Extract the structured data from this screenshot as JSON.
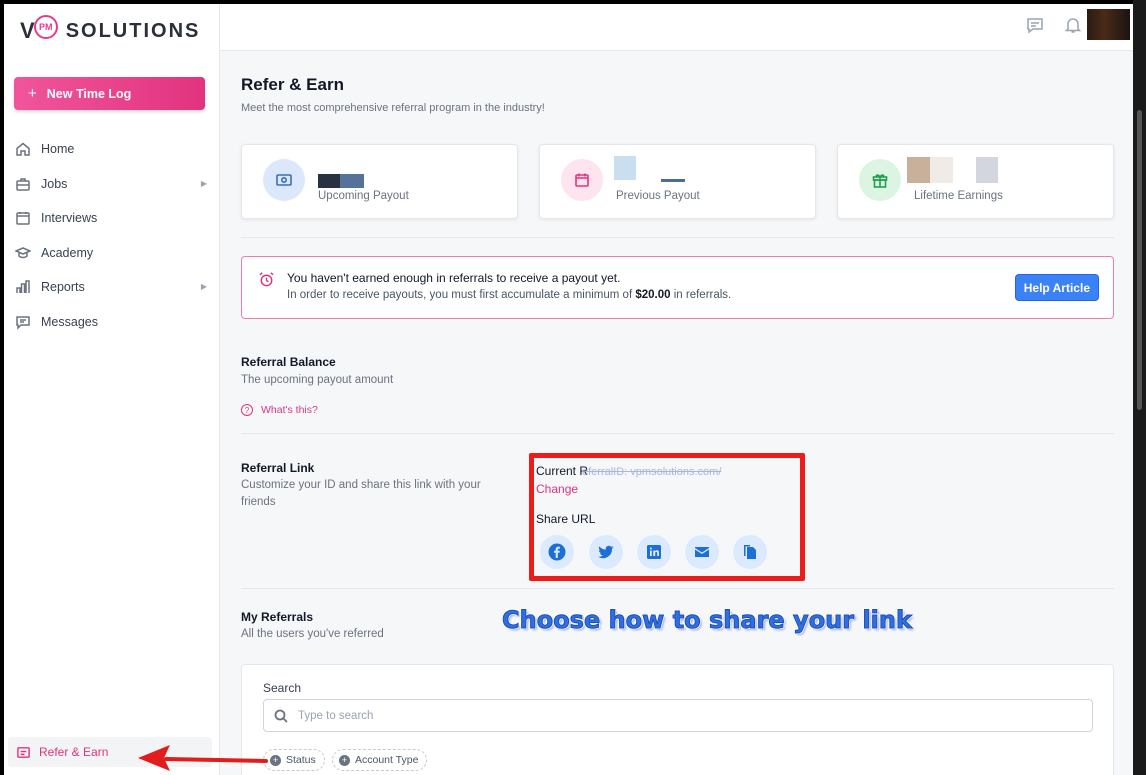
{
  "brand": {
    "v": "V",
    "pm": "PM",
    "name": "SOLUTIONS"
  },
  "sidebar": {
    "new_button": {
      "plus": "+",
      "label": "New Time Log"
    },
    "items": [
      {
        "label": "Home",
        "icon": "home-icon"
      },
      {
        "label": "Jobs",
        "icon": "briefcase-icon",
        "has_arrow": true
      },
      {
        "label": "Interviews",
        "icon": "calendar-icon"
      },
      {
        "label": "Academy",
        "icon": "graduation-cap-icon"
      },
      {
        "label": "Reports",
        "icon": "bar-chart-icon",
        "has_arrow": true
      },
      {
        "label": "Messages",
        "icon": "message-icon"
      }
    ],
    "arrow_glyph": "▶",
    "refer": {
      "label": "Refer & Earn",
      "icon": "gift-card-icon"
    }
  },
  "page": {
    "title": "Refer & Earn",
    "subtitle": "Meet the most comprehensive referral program in the industry!"
  },
  "cards": [
    {
      "label": "Upcoming Payout",
      "icon": "money-icon",
      "circle_color": "#dbe7fb",
      "icon_color": "#3b6fb8"
    },
    {
      "label": "Previous Payout",
      "icon": "calendar-icon",
      "circle_color": "#fde4ee",
      "icon_color": "#e2337f"
    },
    {
      "label": "Lifetime Earnings",
      "icon": "gift-icon",
      "circle_color": "#dcf5e3",
      "icon_color": "#22a04b"
    }
  ],
  "alert": {
    "line1": "You haven't earned enough in referrals to receive a payout yet.",
    "line2_pre": "In order to receive payouts, you must first accumulate a minimum of ",
    "line2_amount": "$20.00",
    "line2_post": " in referrals.",
    "button": "Help Article"
  },
  "balance": {
    "title": "Referral Balance",
    "subtitle": "The upcoming payout amount",
    "whats_q": "?",
    "whats_this": "What's this?"
  },
  "referral_link": {
    "title": "Referral Link",
    "subtitle": "Customize your ID and share this link with your friends",
    "current_label": "Current R",
    "current_url": "eferralID: vpmsolutions.com/",
    "change": "Change",
    "share_label": "Share URL",
    "share_icons": [
      "facebook-icon",
      "twitter-icon",
      "linkedin-icon",
      "email-icon",
      "copy-icon"
    ]
  },
  "annotation": "Choose how to share your link",
  "my_referrals": {
    "title": "My Referrals",
    "subtitle": "All the users you've referred",
    "search_label": "Search",
    "search_placeholder": "Type to search",
    "filters": [
      {
        "plus": "+",
        "label": "Status"
      },
      {
        "plus": "+",
        "label": "Account Type"
      }
    ]
  },
  "colors": {
    "accent": "#e2337f",
    "primary_button": "#3b82f6",
    "highlight_box": "#ee1b1b",
    "annotation": "#2f6fe0"
  }
}
